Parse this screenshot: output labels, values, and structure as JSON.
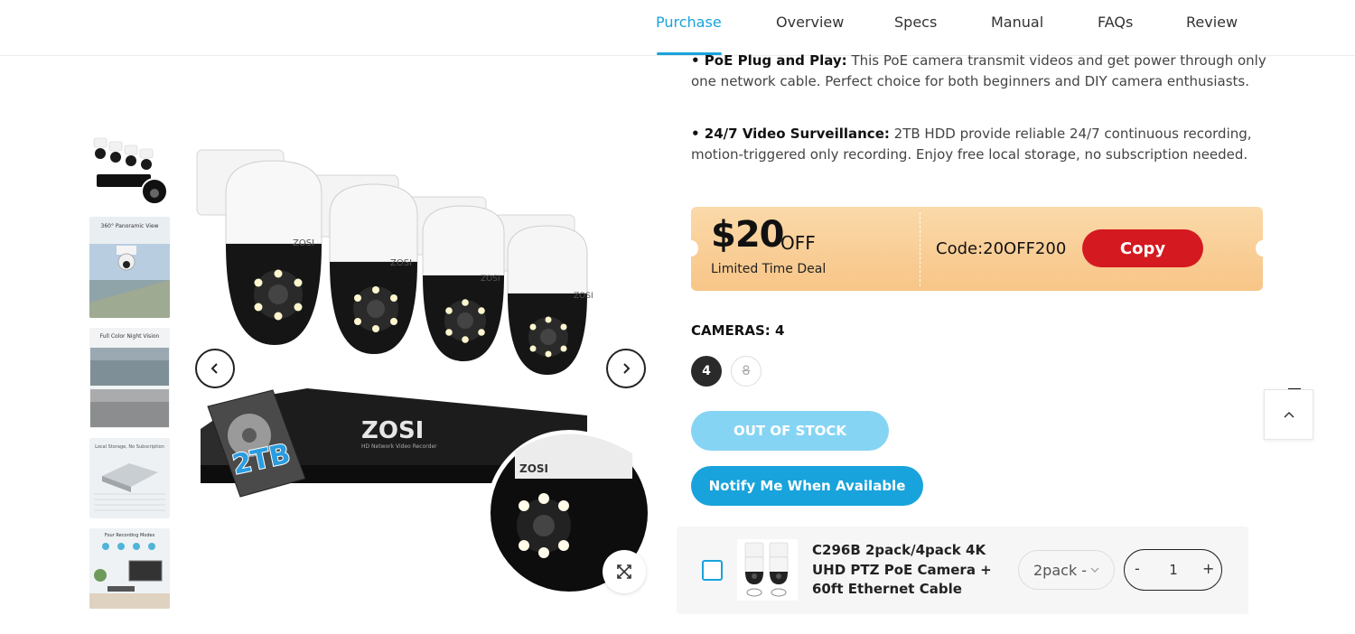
{
  "nav": {
    "tabs": [
      {
        "label": "Purchase",
        "active": true
      },
      {
        "label": "Overview"
      },
      {
        "label": "Specs"
      },
      {
        "label": "Manual"
      },
      {
        "label": "FAQs"
      },
      {
        "label": "Review"
      }
    ]
  },
  "gallery": {
    "thumbnails": [
      {
        "caption": ""
      },
      {
        "caption": "360° Panoramic View"
      },
      {
        "caption": "Full Color Night Vision"
      },
      {
        "caption": "Local Storage, No Subscription"
      },
      {
        "caption": "Four Recording Modes"
      }
    ],
    "main_image": {
      "camera_brand": "ZOSI",
      "nvr_brand": "ZOSI",
      "nvr_subtitle": "HD Network Video Recorder",
      "hdd_label": "2TB"
    }
  },
  "description": {
    "bullet1_title": "• PoE Plug and Play:",
    "bullet1_text": "This PoE camera transmit videos and get power through only one network cable. Perfect choice for both beginners and DIY camera enthusiasts.",
    "bullet2_title": "• 24/7 Video Surveillance:",
    "bullet2_text": "2TB HDD provide reliable 24/7 continuous recording, motion-triggered only recording. Enjoy free local storage, no subscription needed."
  },
  "coupon": {
    "amount": "$20",
    "off": "OFF",
    "subtitle": "Limited Time Deal",
    "code": "Code:20OFF200",
    "copy_label": "Copy"
  },
  "options": {
    "label": "CAMERAS: 4",
    "values": [
      {
        "label": "4",
        "selected": true
      },
      {
        "label": "8",
        "available": false
      }
    ]
  },
  "actions": {
    "out_of_stock_label": "OUT OF STOCK",
    "notify_label": "Notify Me When Available"
  },
  "addon": {
    "title": "C296B 2pack/4pack 4K UHD PTZ PoE Camera + 60ft Ethernet Cable",
    "variant": "2pack -",
    "quantity": "1",
    "minus": "-",
    "plus": "+"
  },
  "colors": {
    "accent": "#19a3dc",
    "copy_button": "#d41920",
    "coupon_bg": "#f9cf98",
    "out_of_stock": "#86d4f3"
  }
}
